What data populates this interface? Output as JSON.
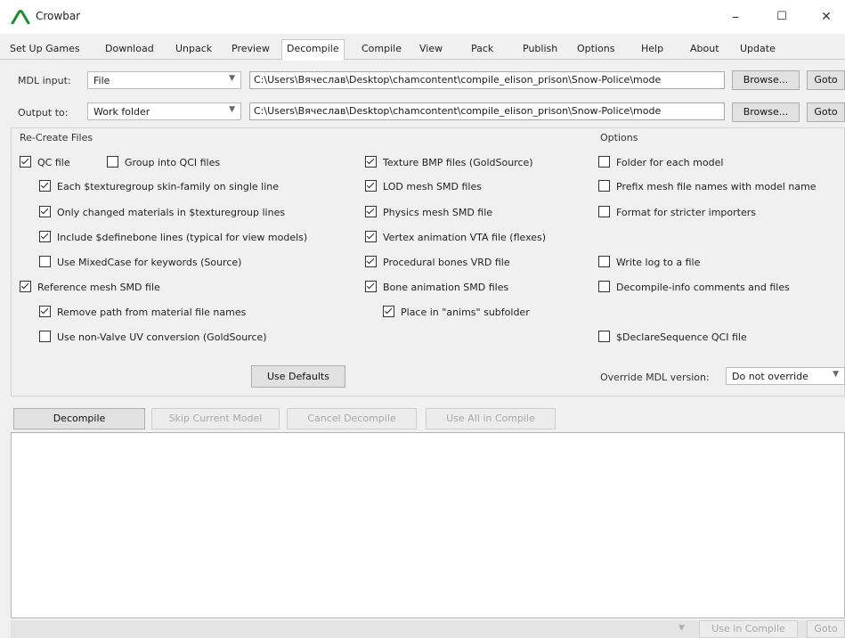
{
  "window": {
    "title": "Crowbar",
    "controls": {
      "minimize": "–",
      "maximize": "☐",
      "close": "✕"
    }
  },
  "tabs": [
    {
      "label": "Set Up Games"
    },
    {
      "label": "Download"
    },
    {
      "label": "Unpack"
    },
    {
      "label": "Preview"
    },
    {
      "label": "Decompile",
      "active": true
    },
    {
      "label": "Compile"
    },
    {
      "label": "View"
    },
    {
      "label": "Pack"
    },
    {
      "label": "Publish"
    },
    {
      "label": "Options"
    },
    {
      "label": "Help"
    },
    {
      "label": "About"
    },
    {
      "label": "Update"
    }
  ],
  "mdl_input": {
    "label": "MDL input:",
    "mode": "File",
    "path": "C:\\Users\\Вячеслав\\Desktop\\chamcontent\\compile_elison_prison\\Snow-Police\\mode",
    "browse": "Browse...",
    "goto": "Goto"
  },
  "output_to": {
    "label": "Output to:",
    "mode": "Work folder",
    "path": "C:\\Users\\Вячеслав\\Desktop\\chamcontent\\compile_elison_prison\\Snow-Police\\mode",
    "browse": "Browse...",
    "goto": "Goto"
  },
  "recreate": {
    "title": "Re-Create Files",
    "qc_file": {
      "label": "QC file",
      "checked": true
    },
    "group_qci": {
      "label": "Group into QCI files",
      "checked": false
    },
    "texturegroup_single_line": {
      "label": "Each $texturegroup skin-family on single line",
      "checked": true
    },
    "only_changed_materials": {
      "label": "Only changed materials in $texturegroup lines",
      "checked": true
    },
    "definebone_lines": {
      "label": "Include $definebone lines (typical for view models)",
      "checked": true
    },
    "mixedcase": {
      "label": "Use MixedCase for keywords (Source)",
      "checked": false
    },
    "reference_mesh": {
      "label": "Reference mesh SMD file",
      "checked": true
    },
    "remove_path": {
      "label": "Remove path from material file names",
      "checked": true
    },
    "non_valve_uv": {
      "label": "Use non-Valve UV conversion (GoldSource)",
      "checked": false
    },
    "texture_bmp": {
      "label": "Texture BMP files (GoldSource)",
      "checked": true
    },
    "lod_mesh": {
      "label": "LOD mesh SMD files",
      "checked": true
    },
    "physics_mesh": {
      "label": "Physics mesh SMD file",
      "checked": true
    },
    "vertex_anim": {
      "label": "Vertex animation VTA file (flexes)",
      "checked": true
    },
    "procedural_bones": {
      "label": "Procedural bones VRD file",
      "checked": true
    },
    "bone_anim": {
      "label": "Bone animation SMD files",
      "checked": true
    },
    "anims_subfolder": {
      "label": "Place in \"anims\" subfolder",
      "checked": true
    },
    "use_defaults": "Use Defaults"
  },
  "options": {
    "title": "Options",
    "folder_each_model": {
      "label": "Folder for each model",
      "checked": false
    },
    "prefix_mesh": {
      "label": "Prefix mesh file names with model name",
      "checked": false
    },
    "stricter_importers": {
      "label": "Format for stricter importers",
      "checked": false
    },
    "write_log": {
      "label": "Write log to a file",
      "checked": false
    },
    "decompile_info": {
      "label": "Decompile-info comments and files",
      "checked": false
    },
    "declare_sequence": {
      "label": "$DeclareSequence QCI file",
      "checked": false
    },
    "override_label": "Override MDL version:",
    "override_value": "Do not override"
  },
  "actions": {
    "decompile": "Decompile",
    "skip": "Skip Current Model",
    "cancel": "Cancel Decompile",
    "use_in_compile": "Use All in Compile"
  },
  "bottom": {
    "use_in_compile": "Use in Compile",
    "goto": "Goto"
  },
  "colors": {
    "logo": "#1f8a2e",
    "window_bg": "#f0f0f0",
    "border": "#adadad"
  }
}
